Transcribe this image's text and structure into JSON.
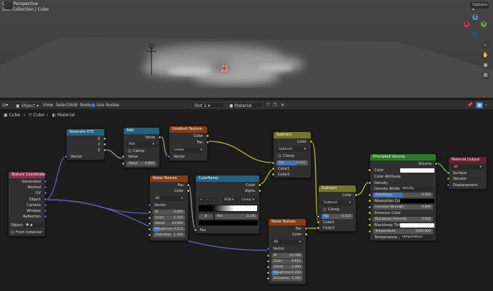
{
  "viewport": {
    "mode": "User Perspective",
    "collection": "(80) Collection | Cube",
    "options": "Options"
  },
  "header": {
    "editor_menu": "Object",
    "view": "View",
    "select": "Select",
    "add": "Add",
    "node": "Node",
    "use_nodes": "Use Nodes",
    "slot": "Slot 1",
    "material": "Material"
  },
  "breadcrumb": {
    "object": "Cube",
    "mesh": "Cube",
    "material": "Material"
  },
  "colors": {
    "yellow_socket": "#c7c729",
    "grey_socket": "#a1a1a1",
    "vector_socket": "#6363c7",
    "shader_socket": "#63c763",
    "texture_header": "#873d13",
    "converter_header": "#246283",
    "input_header": "#83314a",
    "math_header": "#75752a",
    "shader_header": "#2a7a2a",
    "output_header": "#6b1e2d"
  },
  "nodes": {
    "texcoord": {
      "title": "Texture Coordinate",
      "outputs": [
        "Generated",
        "Normal",
        "UV",
        "Object",
        "Camera",
        "Window",
        "Reflection"
      ],
      "object_label": "Object:",
      "from_instancer": "From Instancer"
    },
    "separate": {
      "title": "Separate XYZ",
      "outputs": [
        "X",
        "Y",
        "Z"
      ],
      "input": "Vector"
    },
    "add": {
      "title": "Add",
      "output": "Value",
      "op": "Add",
      "clamp": "Clamp",
      "in_value": "Value",
      "value_label": "Value",
      "value": "0.880"
    },
    "gradient": {
      "title": "Gradient Texture",
      "outputs": [
        "Color",
        "Fac"
      ],
      "type": "Linear",
      "input": "Vector"
    },
    "noise1": {
      "title": "Noise Texture",
      "outputs": [
        "Fac",
        "Color"
      ],
      "dim": "4D",
      "input": "Vector",
      "fields": [
        {
          "label": "W",
          "value": "0.000"
        },
        {
          "label": "Scale",
          "value": "1.350"
        },
        {
          "label": "Detail",
          "value": "10.900"
        },
        {
          "label": "Roughness",
          "value": "0.213"
        },
        {
          "label": "Distortion",
          "value": "1.100"
        }
      ]
    },
    "colorramp": {
      "title": "ColorRamp",
      "outputs": [
        "Color",
        "Alpha"
      ],
      "mode": "RGB",
      "interp": "Linear",
      "index": "0",
      "pos_label": "Pos",
      "pos": "0.245",
      "input": "Fac",
      "plus": "+",
      "minus": "−",
      "menu": "⌄"
    },
    "sub1": {
      "title": "Subtract",
      "output": "Color",
      "op": "Subtract",
      "clamp": "Clamp",
      "fac_label": "Fac",
      "fac": "0.642",
      "inputs": [
        "Color1",
        "Color2"
      ]
    },
    "sub2": {
      "title": "Subtract",
      "output": "Color",
      "op": "Subtract",
      "clamp": "Clamp",
      "fac_label": "Fac",
      "fac": "0.233",
      "inputs": [
        "Color1",
        "Color2"
      ]
    },
    "noise2": {
      "title": "Noise Texture",
      "outputs": [
        "Fac",
        "Color"
      ],
      "dim": "4D",
      "input": "Vector",
      "fields": [
        {
          "label": "W",
          "value": "22.500"
        },
        {
          "label": "Scale",
          "value": "4.610"
        },
        {
          "label": "Detail",
          "value": "2.000"
        },
        {
          "label": "Roughness",
          "value": "0.200"
        },
        {
          "label": "Distortion",
          "value": "0.290"
        }
      ]
    },
    "volume": {
      "title": "Principled Volume",
      "output": "Volume",
      "color": "Color",
      "color_attr": "Color Attribute",
      "density": "Density",
      "density_attr": "Density Attribu...",
      "density_attr_val": "density",
      "aniso": "Anisotropy",
      "aniso_val": "0.500",
      "absorb": "Absorption Col...",
      "emission_strength": "Emission Strength",
      "emission_strength_val": "0.890",
      "emission_color": "Emission Color",
      "bb_intensity": "Blackbody Intensity",
      "bb_intensity_val": "0.000",
      "bb_tint": "Blackbody Tint",
      "temperature": "Temperature",
      "temperature_val": "1000.000",
      "temp_attr": "Temperature ...",
      "temp_attr_val": "temperature"
    },
    "output": {
      "title": "Material Output",
      "target": "All",
      "inputs": [
        "Surface",
        "Volume",
        "Displacement"
      ]
    }
  }
}
